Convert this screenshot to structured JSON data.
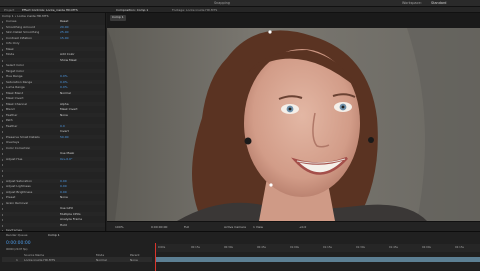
{
  "topbar": {
    "menu": "",
    "snapping": "Snapping",
    "workspace_label": "Workspace:",
    "workspace_value": "Standard"
  },
  "panels": {
    "project_tab": "Project",
    "effect_controls_tab": "Effect Controls: Locke_inside HD.MTS",
    "composition_tab": "Composition: Comp 1",
    "footage_tab": "Footage: Locke inside HD.MTS",
    "comp_chip": "Comp 1"
  },
  "effect_controls": {
    "layer_path": "Comp 1 • Locke inside HD.MTS",
    "rows": [
      {
        "name": "Curves",
        "value": "Reset",
        "kind": "white"
      },
      {
        "name": "Smoothing Amount",
        "value": "20.00",
        "kind": "blue"
      },
      {
        "name": "Skin Detail Smoothing",
        "value": "25.00",
        "kind": "blue"
      },
      {
        "name": "Contrast Inflation",
        "value": "15.00",
        "kind": "blue"
      },
      {
        "name": "Info Only",
        "value": "",
        "kind": "white"
      },
      {
        "name": "Mask",
        "value": "",
        "kind": "white"
      },
      {
        "name": "Mode",
        "value": "Add Color",
        "kind": "white"
      },
      {
        "name": "",
        "value": "Show Mask",
        "kind": "white"
      },
      {
        "name": "Select Color",
        "value": "",
        "kind": "white"
      },
      {
        "name": "Target Color",
        "value": "",
        "kind": "white"
      },
      {
        "name": "Hue Range",
        "value": "0.0%",
        "kind": "blue"
      },
      {
        "name": "Saturation Range",
        "value": "0.0%",
        "kind": "blue"
      },
      {
        "name": "Luma Range",
        "value": "0.0%",
        "kind": "blue"
      },
      {
        "name": "Mask Blend",
        "value": "Normal",
        "kind": "white"
      },
      {
        "name": "Mask Invert",
        "value": "",
        "kind": "white"
      },
      {
        "name": "Mask Channel",
        "value": "Alpha",
        "kind": "white"
      },
      {
        "name": "Blend",
        "value": "Mask Invert",
        "kind": "white"
      },
      {
        "name": "Feather",
        "value": "None",
        "kind": "white"
      },
      {
        "name": "Path",
        "value": "",
        "kind": "white"
      },
      {
        "name": "Feather",
        "value": "0.0",
        "kind": "blue"
      },
      {
        "name": "",
        "value": "Invert",
        "kind": "white"
      },
      {
        "name": "Preserve Small Details",
        "value": "50.00",
        "kind": "blue"
      },
      {
        "name": "Overlays",
        "value": "",
        "kind": "white"
      },
      {
        "name": "Color Correction",
        "value": "",
        "kind": "white"
      },
      {
        "name": "",
        "value": "Use Mask",
        "kind": "white"
      },
      {
        "name": "Adjust Hue",
        "value": "0x+0.0°",
        "kind": "blue"
      },
      {
        "name": "",
        "value": "",
        "kind": "white"
      },
      {
        "name": "",
        "value": "",
        "kind": "white"
      },
      {
        "name": "",
        "value": "",
        "kind": "white"
      },
      {
        "name": "Adjust Saturation",
        "value": "0.00",
        "kind": "blue"
      },
      {
        "name": "Adjust Lightness",
        "value": "0.00",
        "kind": "blue"
      },
      {
        "name": "Adjust Brightness",
        "value": "0.00",
        "kind": "blue"
      },
      {
        "name": "Preset",
        "value": "None",
        "kind": "white"
      },
      {
        "name": "Grain Removal",
        "value": "",
        "kind": "white"
      },
      {
        "name": "",
        "value": "Use GPU",
        "kind": "white"
      },
      {
        "name": "",
        "value": "Multiple CPUs",
        "kind": "white"
      },
      {
        "name": "",
        "value": "Analyze Frame",
        "kind": "white"
      },
      {
        "name": "",
        "value": "Hold",
        "kind": "white"
      },
      {
        "name": "Keyframes",
        "value": "",
        "kind": "white"
      }
    ]
  },
  "viewer": {
    "zoom": "100%",
    "timecode": "0:00:00:00",
    "resolution": "Full",
    "camera": "Active Camera",
    "view": "1 View",
    "exposure": "+0.0"
  },
  "timeline": {
    "render_queue_tab": "Render Queue",
    "comp_tab": "Comp 1",
    "timecode": "0:00:00:00",
    "fps": "00000 (29.97 fps)",
    "column_source": "Source Name",
    "column_mode": "Mode",
    "column_parent": "Parent",
    "layer_index": "1",
    "layer_name": "Locke inside HD.MTS",
    "layer_mode": "Normal",
    "layer_parent": "None",
    "ruler": [
      "0:00s",
      "00:15s",
      "00:30s",
      "00:45s",
      "01:00s",
      "01:15s",
      "01:30s",
      "01:45s",
      "02:00s",
      "02:15s"
    ]
  },
  "colors": {
    "accent_blue": "#4d9be8",
    "timeline_bar": "#5c7f93",
    "playhead": "#d9342b"
  }
}
